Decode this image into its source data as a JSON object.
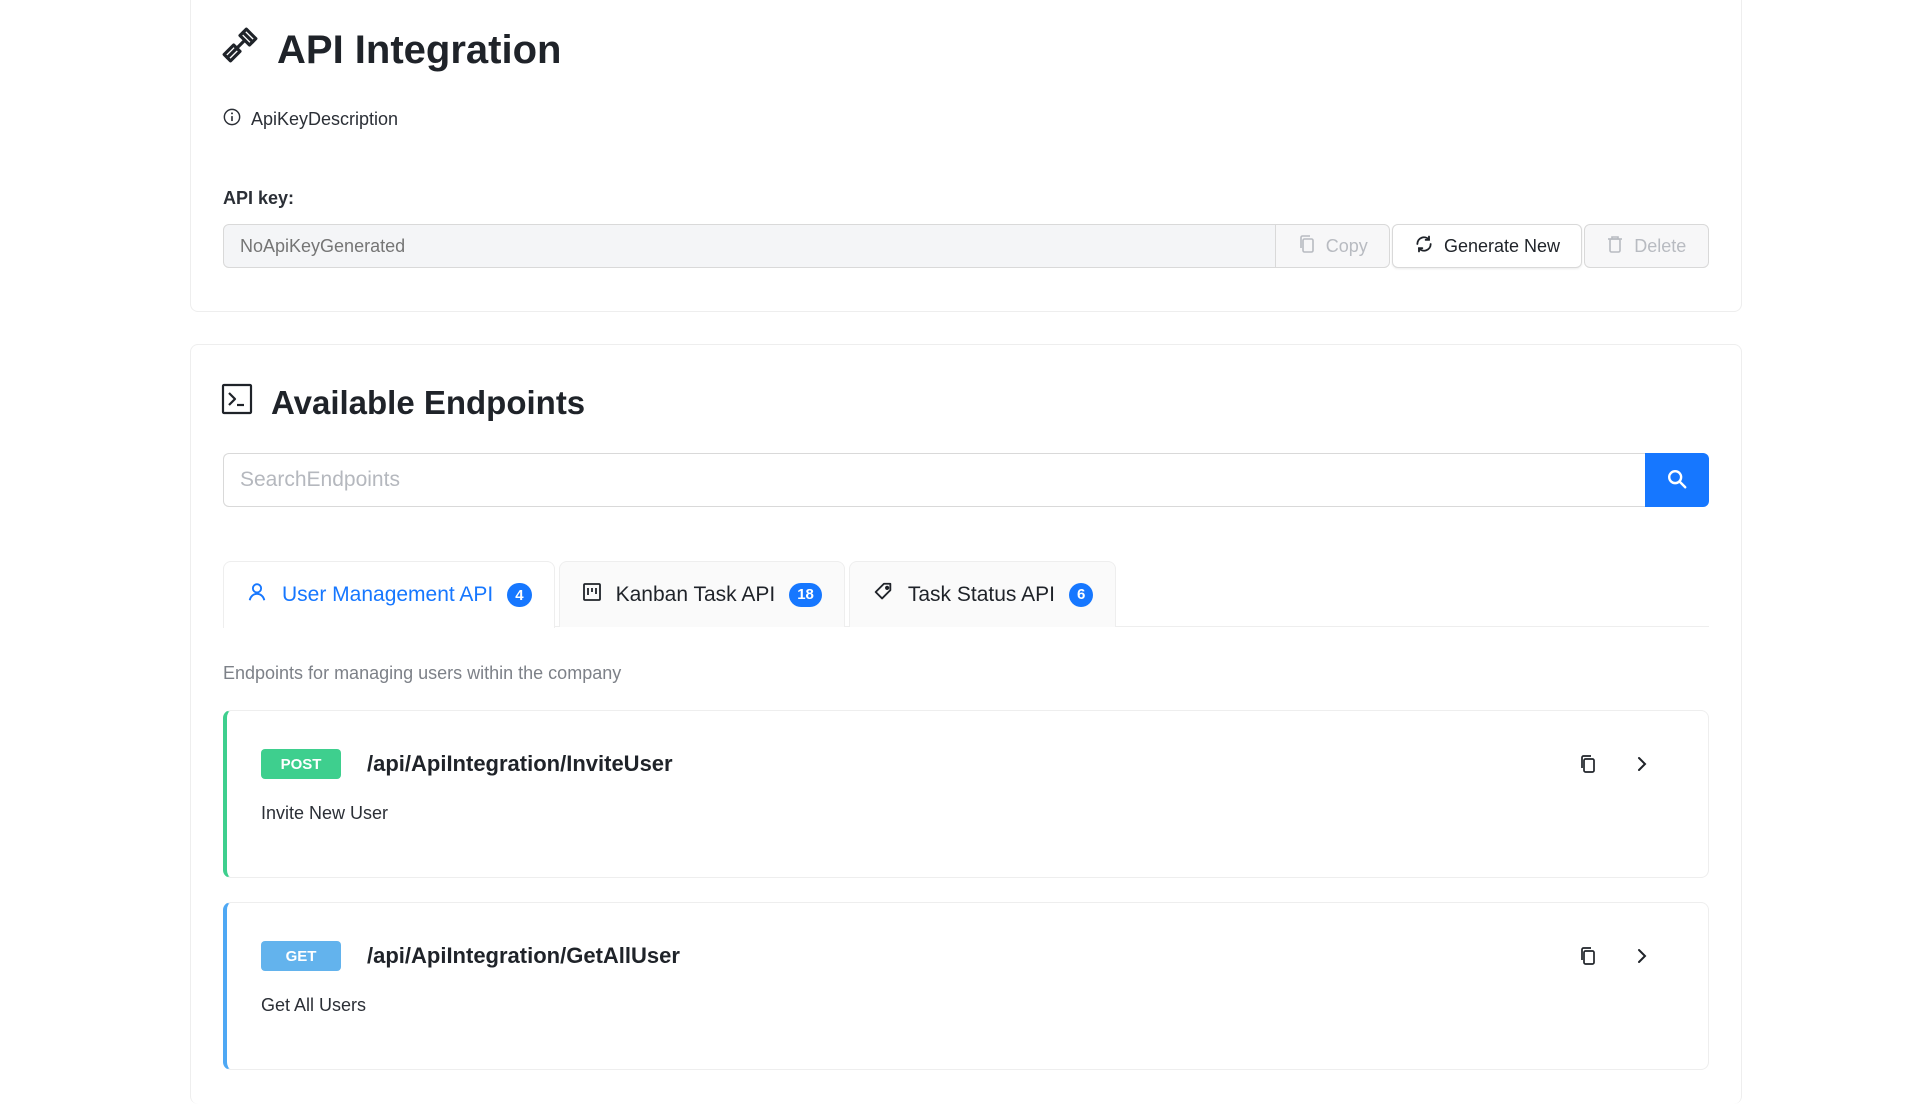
{
  "header": {
    "title": "API Integration",
    "description": "ApiKeyDescription"
  },
  "api_key": {
    "label": "API key:",
    "placeholder": "NoApiKeyGenerated",
    "copy_label": "Copy",
    "generate_label": "Generate New",
    "delete_label": "Delete"
  },
  "endpoints": {
    "title": "Available Endpoints",
    "search_placeholder": "SearchEndpoints",
    "tabs": [
      {
        "label": "User Management API",
        "count": "4",
        "icon": "user-icon"
      },
      {
        "label": "Kanban Task API",
        "count": "18",
        "icon": "kanban-icon"
      },
      {
        "label": "Task Status API",
        "count": "6",
        "icon": "tag-icon"
      }
    ],
    "active_tab_description": "Endpoints for managing users within the company",
    "items": [
      {
        "method": "POST",
        "path": "/api/ApiIntegration/InviteUser",
        "title": "Invite New User"
      },
      {
        "method": "GET",
        "path": "/api/ApiIntegration/GetAllUser",
        "title": "Get All Users"
      }
    ]
  },
  "colors": {
    "accent": "#1677ff",
    "post": "#3ecf8e",
    "get": "#63b3ed"
  }
}
